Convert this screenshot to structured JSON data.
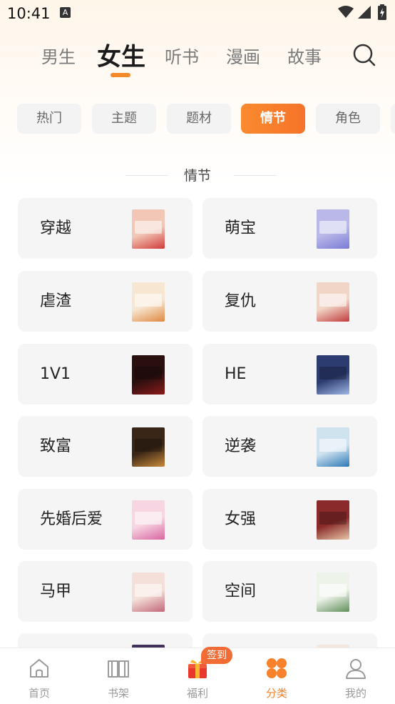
{
  "status_bar": {
    "time": "10:41",
    "notification_icon": "A"
  },
  "top_tabs": [
    {
      "label": "男生",
      "active": false
    },
    {
      "label": "女生",
      "active": true
    },
    {
      "label": "听书",
      "active": false
    },
    {
      "label": "漫画",
      "active": false
    },
    {
      "label": "故事",
      "active": false
    }
  ],
  "sub_tabs": [
    {
      "label": "热门",
      "active": false
    },
    {
      "label": "主题",
      "active": false
    },
    {
      "label": "题材",
      "active": false
    },
    {
      "label": "情节",
      "active": true
    },
    {
      "label": "角色",
      "active": false
    }
  ],
  "section": {
    "title": "情节"
  },
  "categories": [
    {
      "label": "穿越",
      "cover_color": "#f2c7b6",
      "cover_accent": "#d23a3a"
    },
    {
      "label": "萌宝",
      "cover_color": "#b9b8e8",
      "cover_accent": "#7a7ad6"
    },
    {
      "label": "虐渣",
      "cover_color": "#f7e7d2",
      "cover_accent": "#e0893f"
    },
    {
      "label": "复仇",
      "cover_color": "#f1d6c8",
      "cover_accent": "#c23b3b"
    },
    {
      "label": "1V1",
      "cover_color": "#2a0f0f",
      "cover_accent": "#8b1a1a"
    },
    {
      "label": "HE",
      "cover_color": "#2c3c70",
      "cover_accent": "#9fb7e6"
    },
    {
      "label": "致富",
      "cover_color": "#3a2617",
      "cover_accent": "#c98a3a"
    },
    {
      "label": "逆袭",
      "cover_color": "#cfe3ef",
      "cover_accent": "#2b79b6"
    },
    {
      "label": "先婚后爱",
      "cover_color": "#f7d5e2",
      "cover_accent": "#d965a0"
    },
    {
      "label": "女强",
      "cover_color": "#8a2a2a",
      "cover_accent": "#e6c6a6"
    },
    {
      "label": "马甲",
      "cover_color": "#f4e0d8",
      "cover_accent": "#c2677a"
    },
    {
      "label": "空间",
      "cover_color": "#eef3ea",
      "cover_accent": "#5f8f5a"
    },
    {
      "label": "",
      "cover_color": "#40305a",
      "cover_accent": "#40305a"
    },
    {
      "label": "",
      "cover_color": "#f3e7de",
      "cover_accent": "#f3e7de"
    }
  ],
  "bottom_nav": [
    {
      "label": "首页",
      "icon": "home-icon",
      "active": false
    },
    {
      "label": "书架",
      "icon": "bookshelf-icon",
      "active": false
    },
    {
      "label": "福利",
      "icon": "gift-icon",
      "active": false
    },
    {
      "label": "分类",
      "icon": "category-icon",
      "active": true
    },
    {
      "label": "我的",
      "icon": "profile-icon",
      "active": false
    }
  ],
  "badge": {
    "label": "签到"
  },
  "colors": {
    "accent": "#f7822b",
    "chip_bg": "#f3f3f3",
    "card_bg": "#f5f5f5"
  }
}
